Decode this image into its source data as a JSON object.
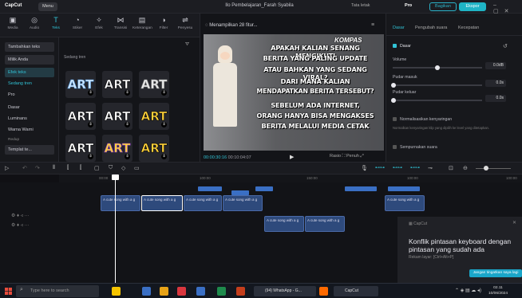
{
  "titlebar": {
    "logo": "CapCut",
    "menu": "Menu",
    "title": "Ilo Pembelajaran_Farah Syabila",
    "layout": "Tata letak",
    "pro": "Pro",
    "share": "Bagikan",
    "export": "Ekspor"
  },
  "toolbar": {
    "tools": [
      {
        "label": "Media",
        "icon": "media-icon"
      },
      {
        "label": "Audio",
        "icon": "audio-icon"
      },
      {
        "label": "Teks",
        "icon": "text-icon"
      },
      {
        "label": "Stiker",
        "icon": "sticker-icon"
      },
      {
        "label": "Efek",
        "icon": "effects-icon"
      },
      {
        "label": "Transisi",
        "icon": "transition-icon"
      },
      {
        "label": "Keterangan",
        "icon": "captions-icon"
      },
      {
        "label": "Filter",
        "icon": "filter-icon"
      },
      {
        "label": "Penyesu",
        "icon": "adjust-icon"
      }
    ]
  },
  "leftnav": {
    "items": [
      {
        "label": "Tambahkan teks",
        "style": "box"
      },
      {
        "label": "Milik Anda",
        "style": "box"
      },
      {
        "label": "Efek teks",
        "style": "sel"
      },
      {
        "label": "Sedang tren",
        "style": "hi"
      },
      {
        "label": "Pro",
        "style": ""
      },
      {
        "label": "Dasar",
        "style": ""
      },
      {
        "label": "Luminans",
        "style": ""
      },
      {
        "label": "Warna Warni",
        "style": ""
      },
      {
        "label": "Redup",
        "style": "muted"
      },
      {
        "label": "Templat te...",
        "style": "box"
      }
    ]
  },
  "gallery": {
    "title": "Sedang tren",
    "tiles": [
      {
        "text": "ART",
        "color": "#cfe8ff",
        "stroke": "#4a8acb"
      },
      {
        "text": "ART",
        "color": "#ffffff",
        "stroke": "#000000"
      },
      {
        "text": "ART",
        "color": "#e9e9e9",
        "stroke": "#888888"
      },
      {
        "text": "ART",
        "color": "#ffffff",
        "stroke": "#000000"
      },
      {
        "text": "ART",
        "color": "#ffffff",
        "stroke": "#000000"
      },
      {
        "text": "ART",
        "color": "#ffd23a",
        "stroke": "#000000"
      },
      {
        "text": "ART",
        "color": "#ffffff",
        "stroke": "#000000"
      },
      {
        "text": "ART",
        "color": "#ffd23a",
        "stroke": "#8a3ccf"
      },
      {
        "text": "ART",
        "color": "#ffd23a",
        "stroke": "#000000"
      }
    ]
  },
  "player": {
    "header": "Menampilkan 28 fitur...",
    "lines": [
      "APAKAH KALIAN SENANG MENGIKUTI",
      "BERITA YANG PALING UPDATE",
      "ATAU BAHKAN YANG SEDANG VIRAL?",
      "DARI MANA KALIAN",
      "MENDAPATKAN BERITA TERSEBUT?",
      "SEBELUM ADA INTERNET,",
      "ORANG HANYA BISA MENGAKSES",
      "BERITA MELALUI MEDIA CETAK"
    ],
    "masthead": "KOMPAS",
    "time_current": "00:00:30:16",
    "time_total": "00:10:04:07",
    "ratio": "Rasio",
    "full": "Penuh"
  },
  "props": {
    "tabs": [
      "Dasar",
      "Pengubah suara",
      "Kecepatan"
    ],
    "section": "Dasar",
    "volume_label": "Volume",
    "volume_value": "0.0dB",
    "fadein_label": "Pudar masuk",
    "fadein_value": "0.0s",
    "fadeout_label": "Pudar keluar",
    "fadeout_value": "0.0s",
    "normalize_label": "Normalisasikan kenyaringan",
    "normalize_desc": "Normalkan kenyaringan klip yang dipilih ke level yang ditetapkan.",
    "enhance_label": "Sempurnakan suara"
  },
  "timeline": {
    "ticks": [
      "00:00",
      "100:00",
      "150:00",
      "100:00",
      "100:00"
    ],
    "clip_label": "A cute song with a g"
  },
  "notification": {
    "app": "CapCut",
    "title": "Konflik pintasan keyboard dengan pintasan yang sudah ada",
    "sub": "Rekam layar: [Ctrl+Alt+P]",
    "button": "Jangan tingatkan saya lagi"
  },
  "taskbar": {
    "search": "Type here to search",
    "whatsapp": "(94) WhatsApp - G...",
    "capcut": "CapCut",
    "time": "02.11",
    "date": "10/06/2024"
  }
}
